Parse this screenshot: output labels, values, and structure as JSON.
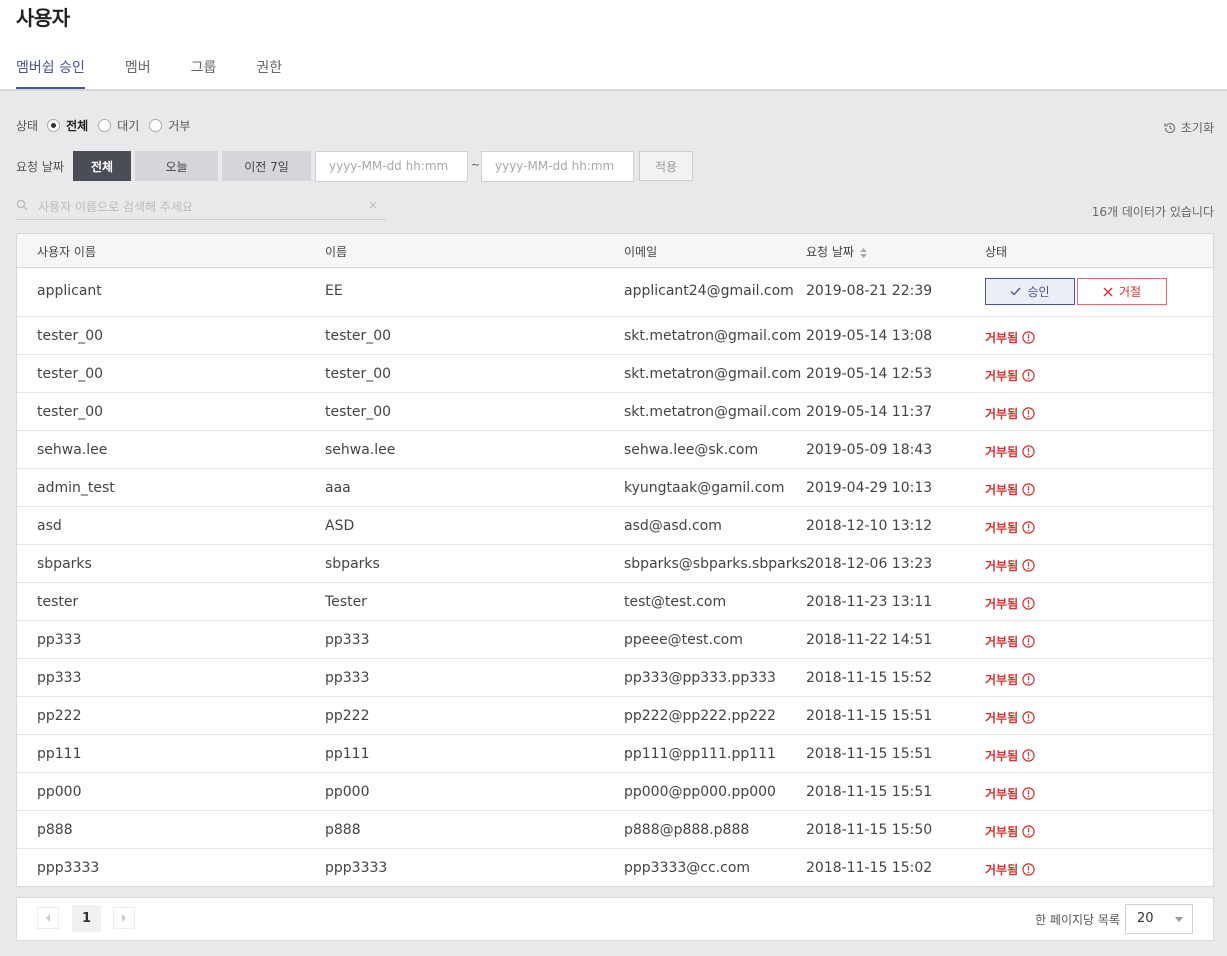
{
  "page": {
    "title": "사용자"
  },
  "tabs": [
    "멤버쉽 승인",
    "멤버",
    "그룹",
    "권한"
  ],
  "filters": {
    "status_label": "상태",
    "status_options": [
      "전체",
      "대기",
      "거부"
    ],
    "status_selected": "전체",
    "reset_label": "초기화",
    "date_label": "요청 날짜",
    "date_buttons": [
      "전체",
      "오늘",
      "이전 7일"
    ],
    "date_selected": "전체",
    "date_from_placeholder": "yyyy-MM-dd hh:mm",
    "date_to_placeholder": "yyyy-MM-dd hh:mm",
    "tilde": "~",
    "apply_label": "적용",
    "search_placeholder": "사용자 이름으로 검색해 주세요",
    "search_clear": "×",
    "count_text": "16개 데이터가 있습니다"
  },
  "table": {
    "headers": [
      "사용자 이름",
      "이름",
      "이메일",
      "요청 날짜",
      "상태"
    ],
    "approve_label": "승인",
    "reject_label": "거절",
    "rejected_label": "거부됨",
    "rows": [
      {
        "username": "applicant",
        "name": "EE",
        "email": "applicant24@gmail.com",
        "date": "2019-08-21 22:39",
        "status": "pending"
      },
      {
        "username": "tester_00",
        "name": "tester_00",
        "email": "skt.metatron@gmail.com",
        "date": "2019-05-14 13:08",
        "status": "rejected"
      },
      {
        "username": "tester_00",
        "name": "tester_00",
        "email": "skt.metatron@gmail.com",
        "date": "2019-05-14 12:53",
        "status": "rejected"
      },
      {
        "username": "tester_00",
        "name": "tester_00",
        "email": "skt.metatron@gmail.com",
        "date": "2019-05-14 11:37",
        "status": "rejected"
      },
      {
        "username": "sehwa.lee",
        "name": "sehwa.lee",
        "email": "sehwa.lee@sk.com",
        "date": "2019-05-09 18:43",
        "status": "rejected"
      },
      {
        "username": "admin_test",
        "name": "aaa",
        "email": "kyungtaak@gamil.com",
        "date": "2019-04-29 10:13",
        "status": "rejected"
      },
      {
        "username": "asd",
        "name": "ASD",
        "email": "asd@asd.com",
        "date": "2018-12-10 13:12",
        "status": "rejected"
      },
      {
        "username": "sbparks",
        "name": "sbparks",
        "email": "sbparks@sbparks.sbparks",
        "date": "2018-12-06 13:23",
        "status": "rejected"
      },
      {
        "username": "tester",
        "name": "Tester",
        "email": "test@test.com",
        "date": "2018-11-23 13:11",
        "status": "rejected"
      },
      {
        "username": "pp333",
        "name": "pp333",
        "email": "ppeee@test.com",
        "date": "2018-11-22 14:51",
        "status": "rejected"
      },
      {
        "username": "pp333",
        "name": "pp333",
        "email": "pp333@pp333.pp333",
        "date": "2018-11-15 15:52",
        "status": "rejected"
      },
      {
        "username": "pp222",
        "name": "pp222",
        "email": "pp222@pp222.pp222",
        "date": "2018-11-15 15:51",
        "status": "rejected"
      },
      {
        "username": "pp111",
        "name": "pp111",
        "email": "pp111@pp111.pp111",
        "date": "2018-11-15 15:51",
        "status": "rejected"
      },
      {
        "username": "pp000",
        "name": "pp000",
        "email": "pp000@pp000.pp000",
        "date": "2018-11-15 15:51",
        "status": "rejected"
      },
      {
        "username": "p888",
        "name": "p888",
        "email": "p888@p888.p888",
        "date": "2018-11-15 15:50",
        "status": "rejected"
      },
      {
        "username": "ppp3333",
        "name": "ppp3333",
        "email": "ppp3333@cc.com",
        "date": "2018-11-15 15:02",
        "status": "rejected"
      }
    ]
  },
  "pagination": {
    "current_page": "1",
    "per_page_label": "한 페이지당 목록",
    "per_page_value": "20"
  },
  "colors": {
    "accent": "#4b5594",
    "rejected": "#d92f2f",
    "dark_button": "#4a4d55"
  }
}
